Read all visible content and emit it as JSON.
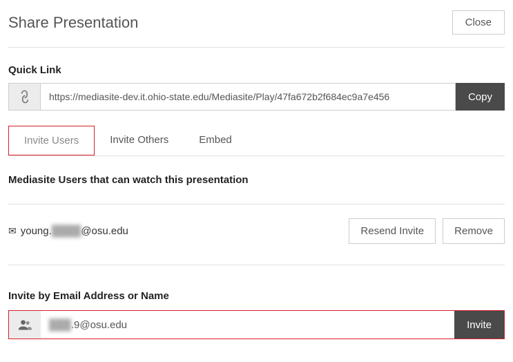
{
  "header": {
    "title": "Share Presentation",
    "close_label": "Close"
  },
  "quick_link": {
    "label": "Quick Link",
    "url": "https://mediasite-dev.it.ohio-state.edu/Mediasite/Play/47fa672b2f684ec9a7e456",
    "copy_label": "Copy"
  },
  "tabs": {
    "invite_users": "Invite Users",
    "invite_others": "Invite Others",
    "embed": "Embed"
  },
  "users_section": {
    "heading": "Mediasite Users that can watch this presentation"
  },
  "user_row": {
    "email_prefix": "young.",
    "email_blur": "████",
    "email_suffix": "@osu.edu",
    "resend_label": "Resend Invite",
    "remove_label": "Remove"
  },
  "invite_section": {
    "label": "Invite by Email Address or Name",
    "input_blur": "███",
    "input_suffix": ".9@osu.edu",
    "invite_label": "Invite"
  }
}
